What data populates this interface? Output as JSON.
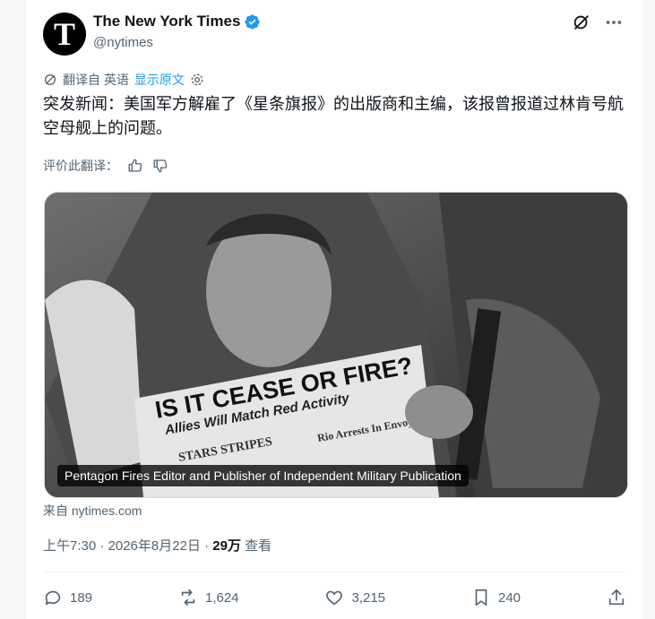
{
  "account": {
    "name": "The New York Times",
    "handle": "@nytimes",
    "avatar_letter": "T"
  },
  "translation": {
    "label": "翻译自 英语",
    "show_original": "显示原文"
  },
  "tweet": {
    "text": "突发新闻：美国军方解雇了《星条旗报》的出版商和主编，该报曾报道过林肯号航空母舰上的问题。"
  },
  "rate": {
    "label": "评价此翻译："
  },
  "media": {
    "headline_line1": "IS IT CEASE OR FIRE?",
    "headline_line2": "Allies Will Match Red Activity",
    "masthead": "STARS STRIPES",
    "side_story": "Rio Arrests In Envoy Case",
    "caption": "Pentagon Fires Editor and Publisher of Independent Military Publication"
  },
  "source": "来自 nytimes.com",
  "meta": {
    "time": "上午7:30 · 2026年8月22日 · ",
    "views": "29万",
    "views_label": " 查看"
  },
  "actions": {
    "replies": "189",
    "reposts": "1,624",
    "likes": "3,215",
    "bookmarks": "240"
  },
  "colors": {
    "accent": "#1d9bf0",
    "text": "#0f1419",
    "secondary": "#536471"
  }
}
